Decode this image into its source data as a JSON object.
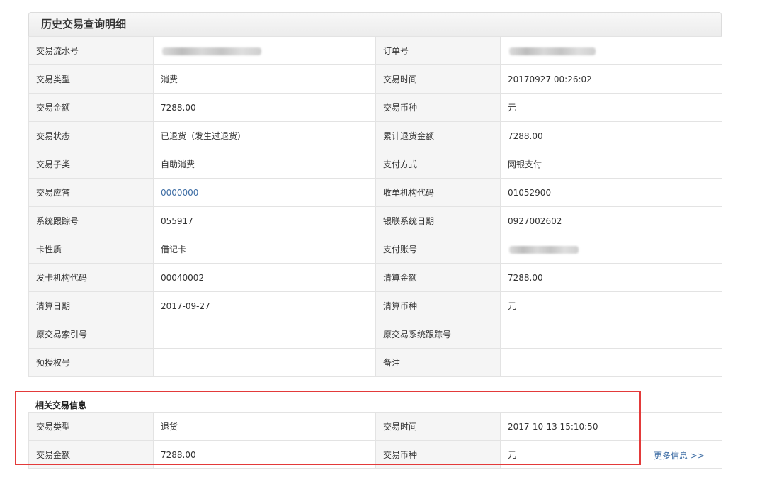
{
  "panel": {
    "title": "历史交易查询明细"
  },
  "details": [
    {
      "label1": "交易流水号",
      "value1": "",
      "label2": "订单号",
      "value2": ""
    },
    {
      "label1": "交易类型",
      "value1": "消费",
      "label2": "交易时间",
      "value2": "20170927 00:26:02"
    },
    {
      "label1": "交易金额",
      "value1": "7288.00",
      "label2": "交易币种",
      "value2": "元"
    },
    {
      "label1": "交易状态",
      "value1": "已退货（发生过退货）",
      "label2": "累计退货金额",
      "value2": "7288.00"
    },
    {
      "label1": "交易子类",
      "value1": "自助消费",
      "label2": "支付方式",
      "value2": "网银支付"
    },
    {
      "label1": "交易应答",
      "value1": "0000000",
      "label2": "收单机构代码",
      "value2": "01052900"
    },
    {
      "label1": "系统跟踪号",
      "value1": "055917",
      "label2": "银联系统日期",
      "value2": "0927002602"
    },
    {
      "label1": "卡性质",
      "value1": "借记卡",
      "label2": "支付账号",
      "value2": ""
    },
    {
      "label1": "发卡机构代码",
      "value1": "00040002",
      "label2": "清算金额",
      "value2": "7288.00"
    },
    {
      "label1": "清算日期",
      "value1": "2017-09-27",
      "label2": "清算币种",
      "value2": "元"
    },
    {
      "label1": "原交易索引号",
      "value1": "",
      "label2": "原交易系统跟踪号",
      "value2": ""
    },
    {
      "label1": "预授权号",
      "value1": "",
      "label2": "备注",
      "value2": ""
    }
  ],
  "related": {
    "title": "相关交易信息",
    "rows": [
      {
        "label1": "交易类型",
        "value1": "退货",
        "label2": "交易时间",
        "value2": "2017-10-13 15:10:50"
      },
      {
        "label1": "交易金额",
        "value1": "7288.00",
        "label2": "交易币种",
        "value2": "元"
      }
    ],
    "more_link": "更多信息 >>"
  },
  "colors": {
    "link": "#3f6ea5",
    "highlight_box": "#e33a3a",
    "label_bg": "#f5f5f5",
    "border": "#e3e3e3"
  }
}
